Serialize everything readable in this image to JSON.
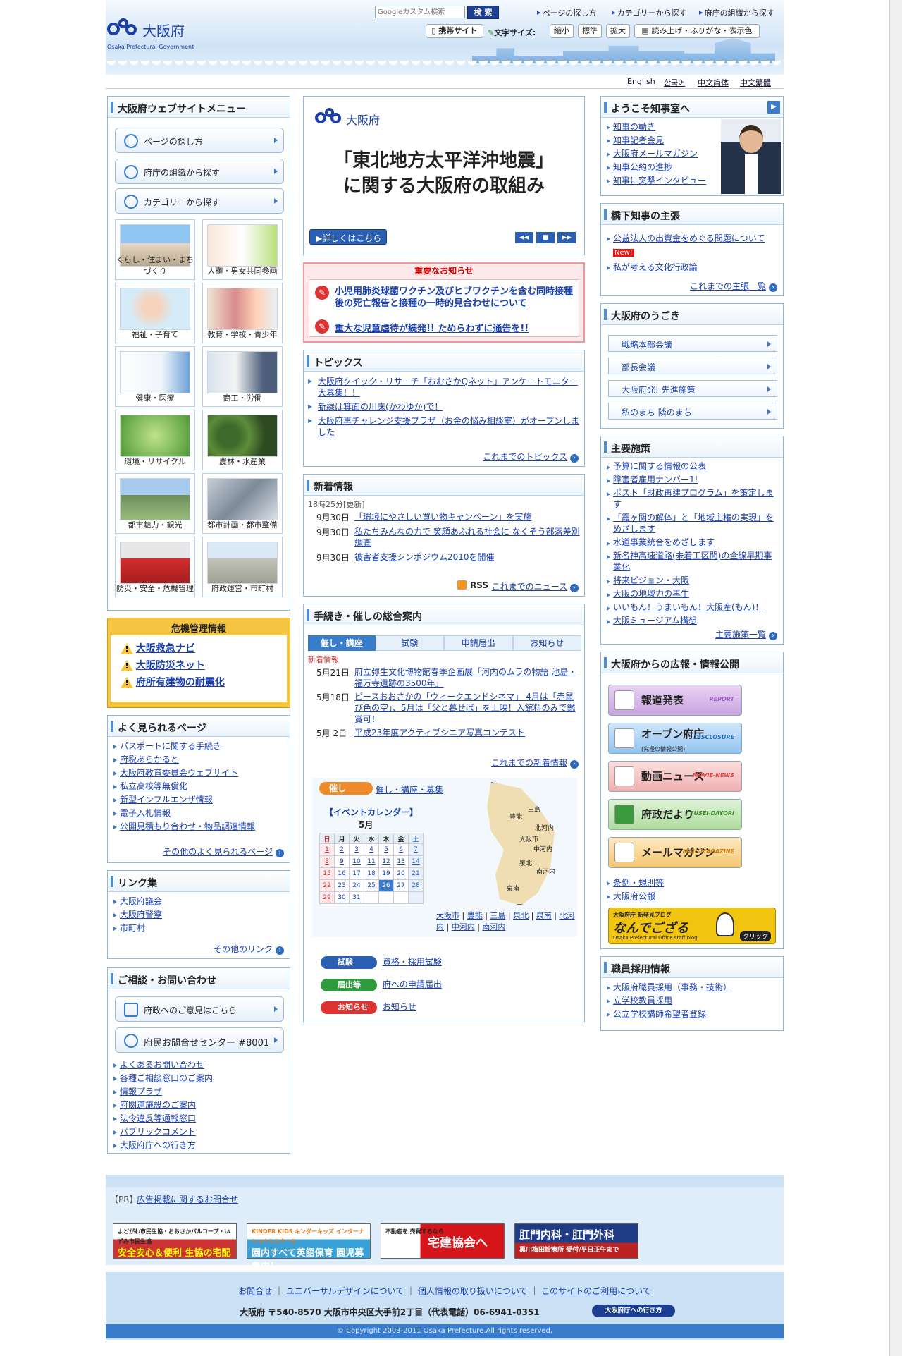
{
  "header": {
    "logo_name": "大阪府",
    "logo_sub": "Osaka Prefectural Government",
    "search_placeholder": "Googleカスタム検索",
    "search_button": "検 索",
    "links": [
      "ページの探し方",
      "カテゴリーから探す",
      "府庁の組織から探す"
    ],
    "mobile_site": "携帯サイト",
    "font_size_label": "文字サイズ:",
    "font_small": "縮小",
    "font_normal": "標準",
    "font_large": "拡大",
    "read_aloud": "読み上げ・ふりがな・表示色",
    "languages": [
      "English",
      "한국어",
      "中文简体",
      "中文繁體"
    ]
  },
  "left_menu": {
    "title": "大阪府ウェブサイトメニュー",
    "nav": [
      "ページの探し方",
      "府庁の組織から探す",
      "カテゴリーから探す"
    ],
    "categories": [
      "くらし・住まい・まちづくり",
      "人権・男女共同参画",
      "福祉・子育て",
      "教育・学校・青少年",
      "健康・医療",
      "商工・労働",
      "環境・リサイクル",
      "農林・水産業",
      "都市魅力・観光",
      "都市計画・都市整備",
      "防災・安全・危機管理",
      "府政運営・市町村"
    ]
  },
  "crisis": {
    "title": "危機管理情報",
    "items": [
      "大阪救急ナビ",
      "大阪防災ネット",
      "府所有建物の耐震化"
    ]
  },
  "popular": {
    "title": "よく見られるページ",
    "items": [
      "パスポートに関する手続き",
      "府税あらかると",
      "大阪府教育委員会ウェブサイト",
      "私立高校等無償化",
      "新型インフルエンザ情報",
      "電子入札情報",
      "公開見積もり合わせ・物品調達情報"
    ],
    "more": "その他のよく見られるページ"
  },
  "links": {
    "title": "リンク集",
    "items": [
      "大阪府議会",
      "大阪府警察",
      "市町村"
    ],
    "more": "その他のリンク"
  },
  "contact": {
    "title": "ご相談・お問い合わせ",
    "btn1": "府政へのご意見はこちら",
    "btn2": "府民お問合せセンター #8001",
    "items": [
      "よくあるお問い合わせ",
      "各種ご相談窓口のご案内",
      "情報プラザ",
      "府関連施設のご案内",
      "法令違反等通報窓口",
      "パブリックコメント",
      "大阪府庁への行き方"
    ]
  },
  "banner": {
    "logo": "大阪府",
    "headline1": "「東北地方太平洋沖地震」",
    "headline2": "に関する大阪府の取組み",
    "detail_button": "詳しくはこちら"
  },
  "important": {
    "title": "重要なお知らせ",
    "items": [
      "小児用肺炎球菌ワクチン及びヒブワクチンを含む同時接種後の死亡報告と接種の一時的見合わせについて",
      "重大な児童虐待が続発!! ためらわずに通告を!!"
    ]
  },
  "topics": {
    "title": "トピックス",
    "items": [
      "大阪府クイック・リサーチ「おおさかQネット」アンケートモニター大募集！！",
      "新緑は箕面の川床(かわゆか)で！",
      "大阪府再チャレンジ支援プラザ（お金の悩み相談室）がオープンしました"
    ],
    "more": "これまでのトピックス"
  },
  "whatsnew": {
    "title": "新着情報",
    "updated": "18時25分[更新]",
    "items": [
      {
        "date": "9月30日",
        "text": "「環境にやさしい買い物キャンペーン」を実施"
      },
      {
        "date": "9月30日",
        "text": "私たちみんなの力で 笑顔あふれる社会に なくそう部落差別調査"
      },
      {
        "date": "9月30日",
        "text": "被害者支援シンポジウム2010を開催"
      }
    ],
    "rss": "RSS",
    "more": "これまでのニュース"
  },
  "procedures": {
    "title": "手続き・催しの総合案内",
    "tabs": [
      "催し・講座",
      "試験",
      "申請届出",
      "お知らせ"
    ],
    "subhead": "新着情報",
    "items": [
      {
        "date": "5月21日",
        "text": "府立弥生文化博物館春季企画展「河内のムラの物語 池島・福万寺遺跡の3500年」"
      },
      {
        "date": "5月18日",
        "text": "ピースおおさかの「ウィークエンドシネマ」 4月は「赤鼠び色の空」、5月は「父と暮せば」を上映！入館料のみで鑑賞可！"
      },
      {
        "date": "5月 2日",
        "text": "平成23年度アクティブシニア写真コンテスト"
      }
    ],
    "more": "これまでの新着情報",
    "event_tag": "催し",
    "event_link": "催し・講座・募集",
    "calendar_title": "【イベントカレンダー】",
    "month": "5月",
    "weekdays": [
      "日",
      "月",
      "火",
      "水",
      "木",
      "金",
      "土"
    ],
    "days": [
      [
        "1",
        "2",
        "3",
        "4",
        "5",
        "6",
        "7"
      ],
      [
        "8",
        "9",
        "10",
        "11",
        "12",
        "13",
        "14"
      ],
      [
        "15",
        "16",
        "17",
        "18",
        "19",
        "20",
        "21"
      ],
      [
        "22",
        "23",
        "24",
        "25",
        "26",
        "27",
        "28"
      ],
      [
        "29",
        "30",
        "31",
        "",
        "",
        "",
        ""
      ]
    ],
    "map_regions": [
      "三島",
      "豊能",
      "北河内",
      "大阪市",
      "中河内",
      "泉北",
      "南河内",
      "泉南"
    ],
    "region_links": [
      "大阪市",
      "豊能",
      "三島",
      "泉北",
      "泉南",
      "北河内",
      "中河内",
      "南河内"
    ],
    "exam_tag": "試験",
    "exam_link": "資格・採用試験",
    "apply_tag": "届出等",
    "apply_link": "府への申請届出",
    "notice_tag": "お知らせ",
    "notice_link": "お知らせ"
  },
  "governor": {
    "title": "ようこそ知事室へ",
    "items": [
      "知事の動き",
      "知事記者会見",
      "大阪府メールマガジン",
      "知事公約の進捗",
      "知事に突撃インタビュー"
    ]
  },
  "opinion": {
    "title": "橋下知事の主張",
    "items": [
      "公益法人の出資金をめぐる問題について",
      "私が考える文化行政論"
    ],
    "new_badge": "New!",
    "more": "これまでの主張一覧"
  },
  "movement": {
    "title": "大阪府のうごき",
    "items": [
      "戦略本部会議",
      "部長会議",
      "大阪府発! 先進施策",
      "私のまち 隣のまち"
    ]
  },
  "policies": {
    "title": "主要施策",
    "items": [
      "予算に関する情報の公表",
      "障害者雇用ナンバー1!",
      "ポスト「財政再建プログラム」を策定します",
      "「霞ヶ関の解体」と「地域主権の実現」をめざします",
      "水道事業統合をめざします",
      "新名神高速道路(未着工区間)の全線早期事業化",
      "将来ビジョン・大阪",
      "大阪の地域力の再生",
      "いいもん！うまいもん！大阪産(もん)！",
      "大阪ミュージアム構想"
    ],
    "more": "主要施策一覧"
  },
  "pr": {
    "title": "大阪府からの広報・情報公開",
    "buttons": [
      {
        "label": "報道発表",
        "en": "REPORT"
      },
      {
        "label": "オープン府庁",
        "sub": "(究極の情報公開)",
        "en": "DISCLOSURE"
      },
      {
        "label": "動画ニュース",
        "en": "MOVIE-NEWS"
      },
      {
        "label": "府政だより",
        "en": "FUSEI-DAYORI"
      },
      {
        "label": "メールマガジン",
        "en": "MAIL-MAGAZINE"
      }
    ],
    "links": [
      "条例・規則等",
      "大阪府公報"
    ],
    "blog_title": "なんでござる",
    "blog_tag": "大阪府庁 新発見ブログ",
    "blog_sub": "Osaka Prefectural Office staff blog",
    "blog_click": "クリック"
  },
  "recruit": {
    "title": "職員採用情報",
    "items": [
      "大阪府職員採用（事務・技術）",
      "立学校教員採用",
      "公立学校講師希望者登録"
    ]
  },
  "footer": {
    "pr_label": "【PR】",
    "pr_link": "広告掲載に関するお問合せ",
    "ads": [
      {
        "top": "よどがわ市民生協・おおさかパルコープ・いずみ市民生協",
        "main": "安全安心＆便利 生協の宅配"
      },
      {
        "top": "KINDER KIDS キンダーキッズ インターナショナルスクール",
        "main": "園内すべて英語保育 園児募集中！"
      },
      {
        "top": "不動産を 売買するなら",
        "main": "宅建協会へ"
      },
      {
        "top": "肛門内科・肛門外科",
        "main": "黒川梅田診療所 受付/平日正午まで"
      }
    ],
    "links": [
      "お問合せ",
      "ユニバーサルデザインについて",
      "個人情報の取り扱いについて",
      "このサイトのご利用について"
    ],
    "address": "大阪府 〒540-8570 大阪市中央区大手前2丁目（代表電話）06-6941-0351",
    "access_button": "大阪府庁への行き方",
    "copyright": "© Copyright 2003-2011 Osaka Prefecture,All rights reserved."
  }
}
